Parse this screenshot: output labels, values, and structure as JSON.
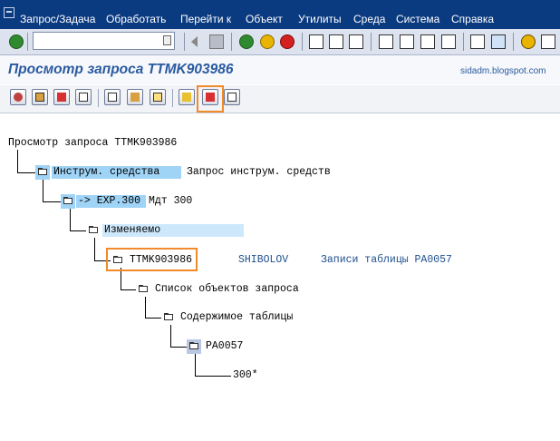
{
  "menu": [
    "Запрос/Задача",
    "Обработать",
    "Перейти к",
    "Объект",
    "Утилиты",
    "Среда",
    "Система",
    "Справка"
  ],
  "title": "Просмотр запроса TTMK903986",
  "watermark": "sidadm.blogspot.com",
  "tree": {
    "root": "Просмотр запроса TTMK903986",
    "node1": {
      "label": "Инструм. средства",
      "desc": "Запрос инструм. средств"
    },
    "node2": {
      "label": "-> EXP.300",
      "desc": "Мдт 300"
    },
    "node3": {
      "label": "Изменяемо"
    },
    "node4": {
      "label": "TTMK903986",
      "owner": "SHIBOLOV",
      "desc": "Записи таблицы PA0057"
    },
    "node5": {
      "label": "Список объектов запроса"
    },
    "node6": {
      "label": "Содержимое таблицы"
    },
    "node7": {
      "label": "PA0057"
    },
    "node8": {
      "label": "300*"
    }
  },
  "colors": {
    "menubar": "#0a3a80",
    "title": "#2a5aa0",
    "selection": "#9fd4f7",
    "highlight": "#f08a2a"
  }
}
